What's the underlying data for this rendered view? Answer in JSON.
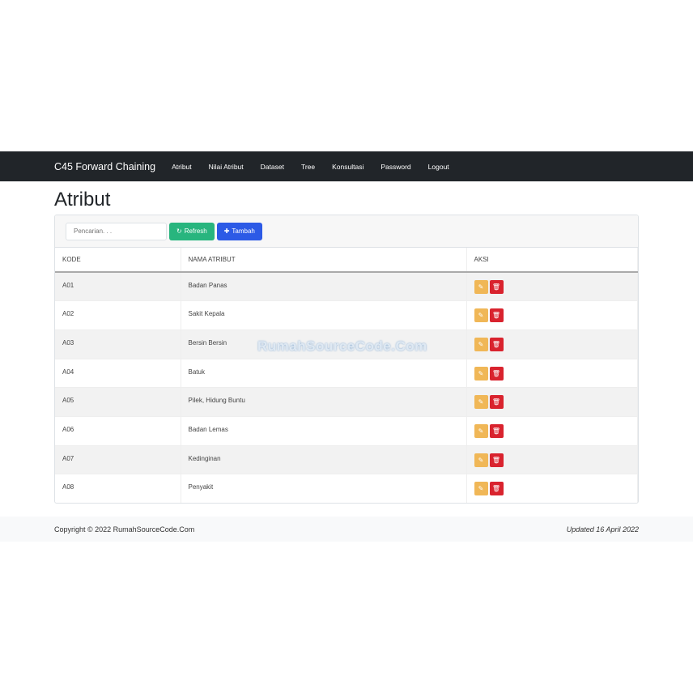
{
  "nav": {
    "brand": "C45 Forward Chaining",
    "items": [
      "Atribut",
      "Nilai Atribut",
      "Dataset",
      "Tree",
      "Konsultasi",
      "Password",
      "Logout"
    ]
  },
  "page_title": "Atribut",
  "toolbar": {
    "search_placeholder": "Pencarian. . .",
    "refresh_label": "Refresh",
    "add_label": "Tambah",
    "refresh_icon": "↻",
    "add_icon": "✚"
  },
  "table": {
    "headers": [
      "KODE",
      "NAMA ATRIBUT",
      "AKSI"
    ],
    "rows": [
      [
        "A01",
        "Badan Panas"
      ],
      [
        "A02",
        "Sakit Kepala"
      ],
      [
        "A03",
        "Bersin Bersin"
      ],
      [
        "A04",
        "Batuk"
      ],
      [
        "A05",
        "Pilek, Hidung Buntu"
      ],
      [
        "A06",
        "Badan Lemas"
      ],
      [
        "A07",
        "Kedinginan"
      ],
      [
        "A08",
        "Penyakit"
      ]
    ]
  },
  "watermark": "RumahSourceCode.Com",
  "footer": {
    "copyright": "Copyright © 2022 RumahSourceCode.Com",
    "updated": "Updated 16 April 2022"
  }
}
